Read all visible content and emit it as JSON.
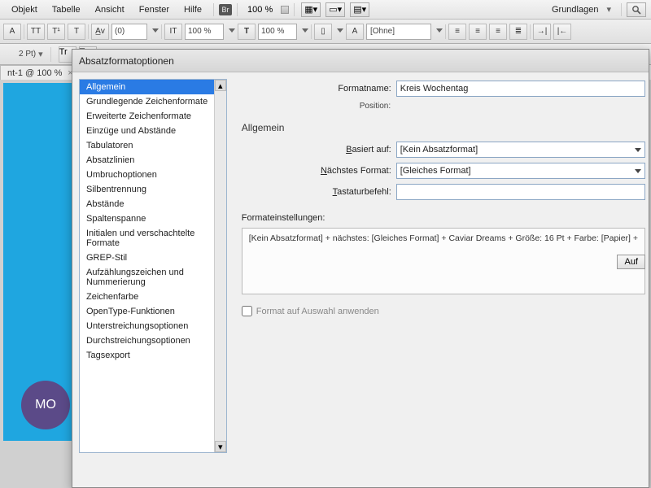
{
  "menubar": {
    "items": [
      "Objekt",
      "Tabelle",
      "Ansicht",
      "Fenster",
      "Hilfe"
    ],
    "badge": "Br",
    "zoom": "100 %",
    "right_label": "Grundlagen"
  },
  "toolbar": {
    "tt_labels": [
      "TT",
      "T¹",
      "T",
      "A̲v",
      "(0)",
      "IT",
      "100 %",
      "T",
      "100 %",
      "A",
      "[Ohne]"
    ],
    "second_row": [
      "Tr",
      "T₁"
    ]
  },
  "doc_tab": "nt-1 @ 100 %",
  "canvas": {
    "circle_text": "MO"
  },
  "dialog": {
    "title": "Absatzformatoptionen",
    "categories": [
      "Allgemein",
      "Grundlegende Zeichenformate",
      "Erweiterte Zeichenformate",
      "Einzüge und Abstände",
      "Tabulatoren",
      "Absatzlinien",
      "Umbruchoptionen",
      "Silbentrennung",
      "Abstände",
      "Spaltenspanne",
      "Initialen und verschachtelte Formate",
      "GREP-Stil",
      "Aufzählungszeichen und Nummerierung",
      "Zeichenfarbe",
      "OpenType-Funktionen",
      "Unterstreichungsoptionen",
      "Durchstreichungsoptionen",
      "Tagsexport"
    ],
    "selected_index": 0,
    "formatname_label": "Formatname:",
    "formatname_value": "Kreis Wochentag",
    "position_label": "Position:",
    "section_title": "Allgemein",
    "based_on_label": "Basiert auf:",
    "based_on_value": "[Kein Absatzformat]",
    "next_label": "Nächstes Format:",
    "next_value": "[Gleiches Format]",
    "shortcut_label": "Tastaturbefehl:",
    "shortcut_value": "",
    "settings_label": "Formateinstellungen:",
    "settings_text": "[Kein Absatzformat] + nächstes: [Gleiches Format] + Caviar Dreams + Größe: 16 Pt + Farbe: [Papier] +",
    "reset_button": "Auf",
    "apply_checkbox_label": "Format auf Auswahl anwenden"
  }
}
